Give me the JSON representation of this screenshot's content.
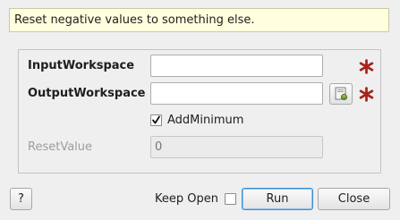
{
  "description": "Reset negative values to something else.",
  "fields": {
    "input_workspace": {
      "label": "InputWorkspace",
      "value": ""
    },
    "output_workspace": {
      "label": "OutputWorkspace",
      "value": ""
    },
    "add_minimum": {
      "label": "AddMinimum",
      "checked": true
    },
    "reset_value": {
      "label": "ResetValue",
      "placeholder": "0"
    }
  },
  "footer": {
    "help_label": "?",
    "keep_open_label": "Keep Open",
    "keep_open_checked": false,
    "run_label": "Run",
    "close_label": "Close"
  },
  "colors": {
    "required_star": "#a8231c",
    "description_bg": "#ffffde",
    "default_button_border": "#3a8fd6"
  },
  "icons": {
    "required": "asterisk-icon",
    "browse": "browse-file-icon",
    "check": "checkmark-icon"
  }
}
